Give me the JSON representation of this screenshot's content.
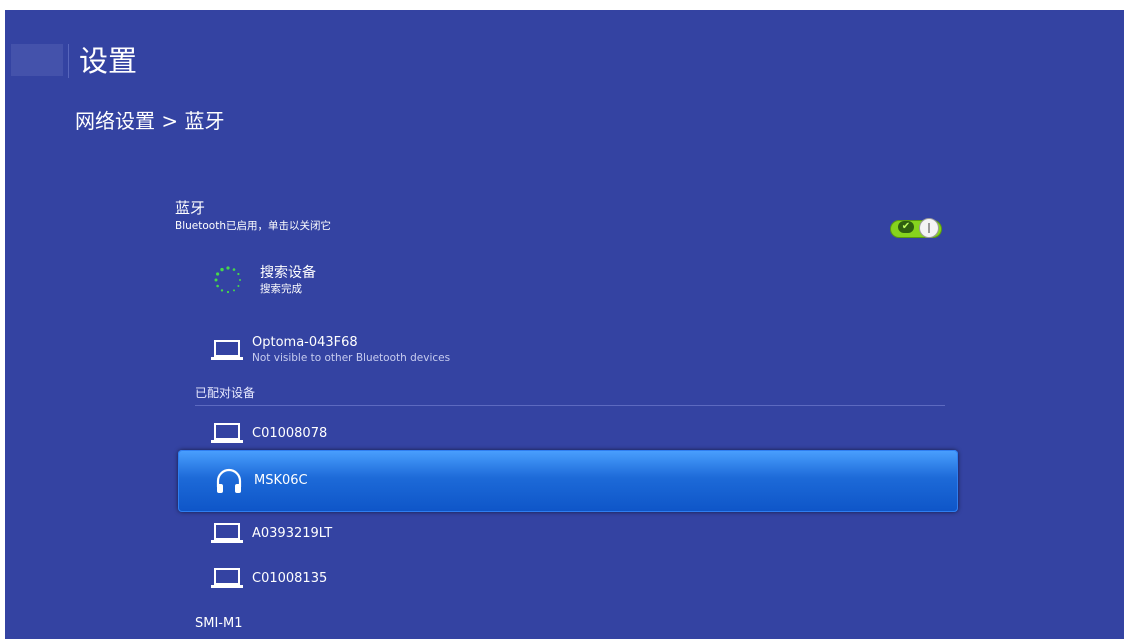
{
  "header": {
    "title": "设置",
    "breadcrumb": "网络设置 > 蓝牙"
  },
  "bluetooth": {
    "title": "蓝牙",
    "subtitle": "Bluetooth已启用，单击以关闭它",
    "toggle_on": true
  },
  "search": {
    "title": "搜索设备",
    "status": "搜索完成",
    "icon": "spinner-icon"
  },
  "this_device": {
    "name": "Optoma-043F68",
    "visibility": "Not visible to other Bluetooth devices",
    "icon": "laptop-icon"
  },
  "paired": {
    "section_label": "已配对设备",
    "devices": [
      {
        "name": "C01008078",
        "icon": "laptop-icon"
      },
      {
        "name": "MSK06C",
        "icon": "headphones-icon",
        "selected": true
      },
      {
        "name": "A0393219LT",
        "icon": "laptop-icon"
      },
      {
        "name": "C01008135",
        "icon": "laptop-icon"
      }
    ]
  },
  "available": {
    "section_label": "SMI-M1"
  },
  "colors": {
    "background": "#3443a2",
    "toggle_on": "#86d31e",
    "selected_row": "#1d6ad8",
    "spinner": "#46d84a"
  }
}
